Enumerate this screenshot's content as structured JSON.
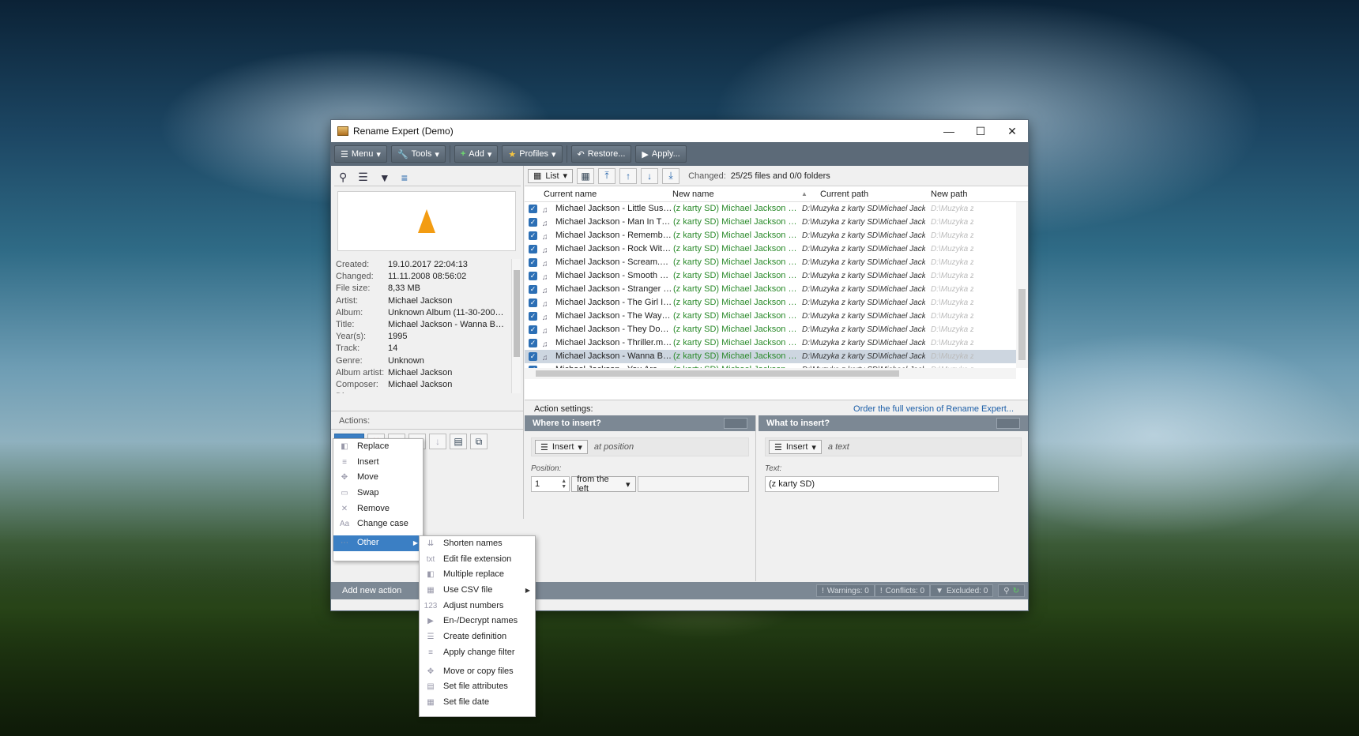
{
  "window": {
    "title": "Rename Expert (Demo)"
  },
  "toolbar": {
    "menu": "Menu",
    "tools": "Tools",
    "add": "Add",
    "profiles": "Profiles",
    "restore": "Restore...",
    "apply": "Apply..."
  },
  "properties": [
    {
      "k": "Created:",
      "v": "19.10.2017 22:04:13"
    },
    {
      "k": "Changed:",
      "v": "11.11.2008 08:56:02"
    },
    {
      "k": "File size:",
      "v": "8,33 MB"
    },
    {
      "k": "Artist:",
      "v": "Michael Jackson"
    },
    {
      "k": "Album:",
      "v": "Unknown Album (11-30-2005..."
    },
    {
      "k": "Title:",
      "v": "Michael Jackson - Wanna Be ..."
    },
    {
      "k": "Year(s):",
      "v": "1995"
    },
    {
      "k": "Track:",
      "v": "14"
    },
    {
      "k": "Genre:",
      "v": "Unknown"
    },
    {
      "k": "Album artist:",
      "v": "Michael Jackson"
    },
    {
      "k": "Composer:",
      "v": "Michael Jackson"
    },
    {
      "k": "Disc:",
      "v": ""
    }
  ],
  "actions": {
    "header": "Actions:"
  },
  "files": {
    "view_label": "List",
    "changed_label": "Changed:",
    "changed_value": "25/25 files and 0/0 folders",
    "columns": {
      "current_name": "Current name",
      "new_name": "New name",
      "current_path": "Current path",
      "new_path": "New path"
    },
    "rows": [
      {
        "cur": "Michael Jackson - Little Susie....",
        "new": "(z karty SD) Michael Jackson - Litt...",
        "path": "D:\\Muzyka z karty SD\\Michael Jackson\\",
        "npath": "D:\\Muzyka z k"
      },
      {
        "cur": "Michael Jackson - Man In The ...",
        "new": "(z karty SD) Michael Jackson - Ma...",
        "path": "D:\\Muzyka z karty SD\\Michael Jackson\\",
        "npath": "D:\\Muzyka z k"
      },
      {
        "cur": "Michael Jackson - Remember ...",
        "new": "(z karty SD) Michael Jackson - Re...",
        "path": "D:\\Muzyka z karty SD\\Michael Jackson\\",
        "npath": "D:\\Muzyka z k"
      },
      {
        "cur": "Michael Jackson - Rock With ...",
        "new": "(z karty SD) Michael Jackson - Ro...",
        "path": "D:\\Muzyka z karty SD\\Michael Jackson\\",
        "npath": "D:\\Muzyka z k"
      },
      {
        "cur": "Michael Jackson - Scream.mp3",
        "new": "(z karty SD) Michael Jackson - Scr...",
        "path": "D:\\Muzyka z karty SD\\Michael Jackson\\",
        "npath": "D:\\Muzyka z k"
      },
      {
        "cur": "Michael Jackson - Smooth Cri...",
        "new": "(z karty SD) Michael Jackson - Sm...",
        "path": "D:\\Muzyka z karty SD\\Michael Jackson\\",
        "npath": "D:\\Muzyka z k"
      },
      {
        "cur": "Michael Jackson - Stranger In ...",
        "new": "(z karty SD) Michael Jackson - Str...",
        "path": "D:\\Muzyka z karty SD\\Michael Jackson\\",
        "npath": "D:\\Muzyka z k"
      },
      {
        "cur": "Michael Jackson - The Girl Is ...",
        "new": "(z karty SD) Michael Jackson - Th...",
        "path": "D:\\Muzyka z karty SD\\Michael Jackson\\",
        "npath": "D:\\Muzyka z k"
      },
      {
        "cur": "Michael Jackson - The Way Yo...",
        "new": "(z karty SD) Michael Jackson - Th...",
        "path": "D:\\Muzyka z karty SD\\Michael Jackson\\",
        "npath": "D:\\Muzyka z k"
      },
      {
        "cur": "Michael Jackson - They Dont ...",
        "new": "(z karty SD) Michael Jackson - Th...",
        "path": "D:\\Muzyka z karty SD\\Michael Jackson\\",
        "npath": "D:\\Muzyka z k"
      },
      {
        "cur": "Michael Jackson - Thriller.mp3",
        "new": "(z karty SD) Michael Jackson - Thr...",
        "path": "D:\\Muzyka z karty SD\\Michael Jackson\\",
        "npath": "D:\\Muzyka z k"
      },
      {
        "cur": "Michael Jackson - Wanna Be S...",
        "new": "(z karty SD) Michael Jackson - Wa...",
        "path": "D:\\Muzyka z karty SD\\Michael Jackson\\",
        "npath": "D:\\Muzyka z k"
      },
      {
        "cur": "Michael Jackson - You Are No...",
        "new": "(z karty SD) Michael Jackson - Yo...",
        "path": "D:\\Muzyka z karty SD\\Michael Jackson\\",
        "npath": "D:\\Muzyka z k"
      }
    ],
    "selected_row": 11
  },
  "action_settings": {
    "header": "Action settings:",
    "order_link": "Order the full version of Rename Expert...",
    "where": {
      "title": "Where to insert?",
      "mode": "Insert",
      "hint": "at position",
      "position_label": "Position:",
      "position_value": "1",
      "direction": "from the left"
    },
    "what": {
      "title": "What to insert?",
      "mode": "Insert",
      "hint": "a text",
      "text_label": "Text:",
      "text_value": "(z karty SD)"
    }
  },
  "status": {
    "add_new_action": "Add new action",
    "warnings": "Warnings: 0",
    "conflicts": "Conflicts: 0",
    "excluded": "Excluded: 0"
  },
  "add_menu": [
    {
      "label": "Replace",
      "icon": "replace-icon"
    },
    {
      "label": "Insert",
      "icon": "insert-icon"
    },
    {
      "label": "Move",
      "icon": "move-icon"
    },
    {
      "label": "Swap",
      "icon": "swap-icon"
    },
    {
      "label": "Remove",
      "icon": "remove-icon"
    },
    {
      "label": "Change case",
      "icon": "change-case-icon"
    },
    {
      "label": "Other",
      "icon": "other-icon",
      "highlighted": true
    }
  ],
  "other_menu": [
    {
      "label": "Shorten names"
    },
    {
      "label": "Edit file extension"
    },
    {
      "label": "Multiple replace"
    },
    {
      "label": "Use CSV file",
      "submenu": true
    },
    {
      "label": "Adjust numbers"
    },
    {
      "label": "En-/Decrypt names"
    },
    {
      "label": "Create definition"
    },
    {
      "label": "Apply change filter"
    },
    {
      "label": "Move or copy files"
    },
    {
      "label": "Set file attributes"
    },
    {
      "label": "Set file date"
    }
  ],
  "colors": {
    "accent": "#3b7fc4",
    "toolbar": "#5c6a78",
    "new_name": "#2a8a2a"
  }
}
